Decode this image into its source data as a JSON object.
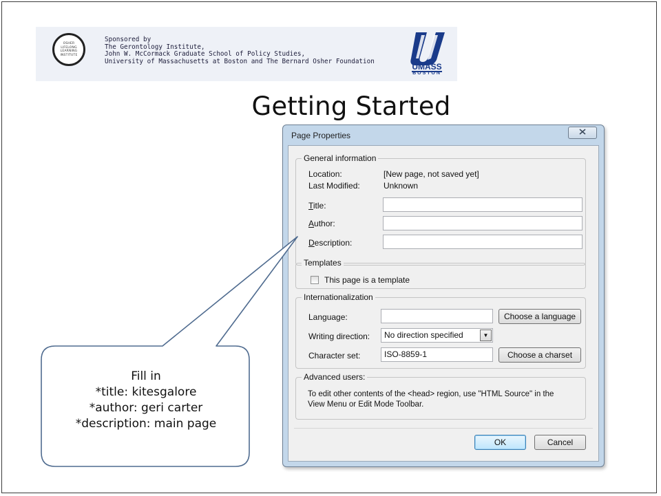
{
  "banner": {
    "osher_logo_text": "OSHER\nLIFELONG\nLEARNING\nINSTITUTE",
    "sponsor_lines": [
      "Sponsored by",
      "The Gerontology Institute,",
      "John W. McCormack Graduate School of Policy Studies,",
      "University of Massachusetts at Boston and The Bernard Osher Foundation"
    ],
    "umass_text": "UMASS",
    "boston_text": "BOSTON"
  },
  "slide_title": "Getting Started",
  "dialog": {
    "title": "Page Properties",
    "close_symbol": "☒",
    "general": {
      "legend": "General information",
      "location_label": "Location:",
      "location_value": "[New page, not saved yet]",
      "modified_label": "Last Modified:",
      "modified_value": "Unknown",
      "title_label_accel": "T",
      "title_label_rest": "itle:",
      "author_label_accel": "A",
      "author_label_rest": "uthor:",
      "description_label_accel": "D",
      "description_label_rest": "escription:",
      "title_value": "",
      "author_value": "",
      "description_value": ""
    },
    "templates": {
      "legend": "Templates",
      "checkbox_label": "This page is a template",
      "checked": false
    },
    "i18n": {
      "legend": "Internationalization",
      "language_label": "Language:",
      "language_value": "",
      "language_button": "Choose a language",
      "direction_label": "Writing direction:",
      "direction_value": "No direction specified",
      "charset_label": "Character set:",
      "charset_value": "ISO-8859-1",
      "charset_button": "Choose a charset"
    },
    "advanced": {
      "legend": "Advanced users:",
      "line1": "To edit other contents of the <head> region, use \"HTML Source\" in the",
      "line2": "View Menu or Edit Mode Toolbar."
    },
    "ok_label": "OK",
    "cancel_label": "Cancel"
  },
  "callout": {
    "lines": [
      "Fill in",
      "*title:  kitesgalore",
      "*author:  geri carter",
      "*description:  main page"
    ]
  },
  "colors": {
    "dialog_frame": "#c3d7ea",
    "dialog_client": "#f0f0f0",
    "callout_stroke": "#4f6b8f",
    "umass_blue": "#1a3b8a"
  }
}
